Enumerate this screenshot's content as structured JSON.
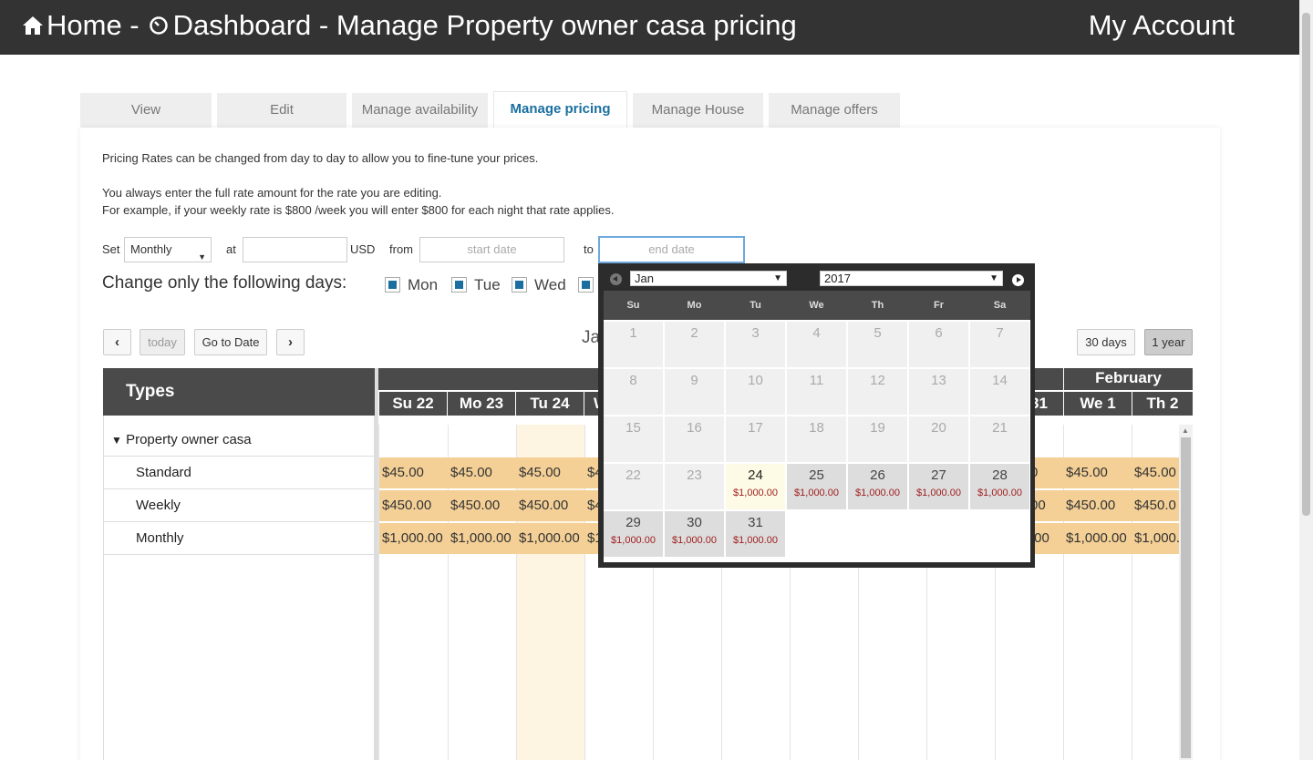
{
  "header": {
    "home_label": "Home -",
    "dashboard_label": "Dashboard - Manage Property owner casa pricing",
    "account_label": "My Account"
  },
  "tabs": [
    {
      "label": "View",
      "active": false
    },
    {
      "label": "Edit",
      "active": false
    },
    {
      "label": "Manage availability",
      "active": false
    },
    {
      "label": "Manage pricing",
      "active": true
    },
    {
      "label": "Manage House",
      "active": false
    },
    {
      "label": "Manage offers",
      "active": false
    }
  ],
  "intro": {
    "line1": "Pricing Rates can be changed from day to day to allow you to fine-tune your prices.",
    "line2": "You always enter the full rate amount for the rate you are editing.",
    "line3": "For example, if your weekly rate is $800 /week you will enter $800 for each night that rate applies."
  },
  "form": {
    "set_label": "Set",
    "rate_type_value": "Monthly",
    "at_label": "at",
    "amount_value": "",
    "currency_label": "USD",
    "from_label": "from",
    "start_placeholder": "start date",
    "to_label": "to",
    "end_placeholder": "end date"
  },
  "days_filter": {
    "label": "Change only the following days:",
    "days": [
      "Mon",
      "Tue",
      "Wed"
    ]
  },
  "calendar_nav": {
    "prev_label": "‹",
    "today_label": "today",
    "goto_label": "Go to Date",
    "next_label": "›",
    "title_partial": "Ja",
    "view_30_label": "30 days",
    "view_year_label": "1 year"
  },
  "grid": {
    "types_header": "Types",
    "group_label": "Property owner casa",
    "rate_rows": [
      "Standard",
      "Weekly",
      "Monthly"
    ],
    "month_label_feb": "February",
    "day_headers": [
      "Su 22",
      "Mo 23",
      "Tu 24",
      "W"
    ],
    "day_headers_right": [
      "31",
      "We 1",
      "Th 2"
    ],
    "rates_left": [
      [
        "$45.00",
        "$45.00",
        "$45.00",
        "$4"
      ],
      [
        "$450.00",
        "$450.00",
        "$450.00",
        "$4"
      ],
      [
        "$1,000.00",
        "$1,000.00",
        "$1,000.00",
        "$1"
      ]
    ],
    "rates_right": [
      [
        "0",
        "$45.00",
        "$45.00"
      ],
      [
        "00",
        "$450.00",
        "$450.0"
      ],
      [
        ".00",
        "$1,000.00",
        "$1,000."
      ]
    ]
  },
  "datepicker": {
    "month_value": "Jan",
    "year_value": "2017",
    "weekdays": [
      "Su",
      "Mo",
      "Tu",
      "We",
      "Th",
      "Fr",
      "Sa"
    ],
    "weeks": [
      [
        {
          "d": "1",
          "p": ""
        },
        {
          "d": "2",
          "p": ""
        },
        {
          "d": "3",
          "p": ""
        },
        {
          "d": "4",
          "p": ""
        },
        {
          "d": "5",
          "p": ""
        },
        {
          "d": "6",
          "p": ""
        },
        {
          "d": "7",
          "p": ""
        }
      ],
      [
        {
          "d": "8",
          "p": ""
        },
        {
          "d": "9",
          "p": ""
        },
        {
          "d": "10",
          "p": ""
        },
        {
          "d": "11",
          "p": ""
        },
        {
          "d": "12",
          "p": ""
        },
        {
          "d": "13",
          "p": ""
        },
        {
          "d": "14",
          "p": ""
        }
      ],
      [
        {
          "d": "15",
          "p": ""
        },
        {
          "d": "16",
          "p": ""
        },
        {
          "d": "17",
          "p": ""
        },
        {
          "d": "18",
          "p": ""
        },
        {
          "d": "19",
          "p": ""
        },
        {
          "d": "20",
          "p": ""
        },
        {
          "d": "21",
          "p": ""
        }
      ],
      [
        {
          "d": "22",
          "p": ""
        },
        {
          "d": "23",
          "p": ""
        },
        {
          "d": "24",
          "p": "$1,000.00"
        },
        {
          "d": "25",
          "p": "$1,000.00"
        },
        {
          "d": "26",
          "p": "$1,000.00"
        },
        {
          "d": "27",
          "p": "$1,000.00"
        },
        {
          "d": "28",
          "p": "$1,000.00"
        }
      ],
      [
        {
          "d": "29",
          "p": "$1,000.00"
        },
        {
          "d": "30",
          "p": "$1,000.00"
        },
        {
          "d": "31",
          "p": "$1,000.00"
        }
      ]
    ],
    "today": "24"
  },
  "colors": {
    "topbar": "#333333",
    "accent": "#1a6fa0",
    "rate_fill": "#f4d096",
    "price_text": "#a02020"
  }
}
